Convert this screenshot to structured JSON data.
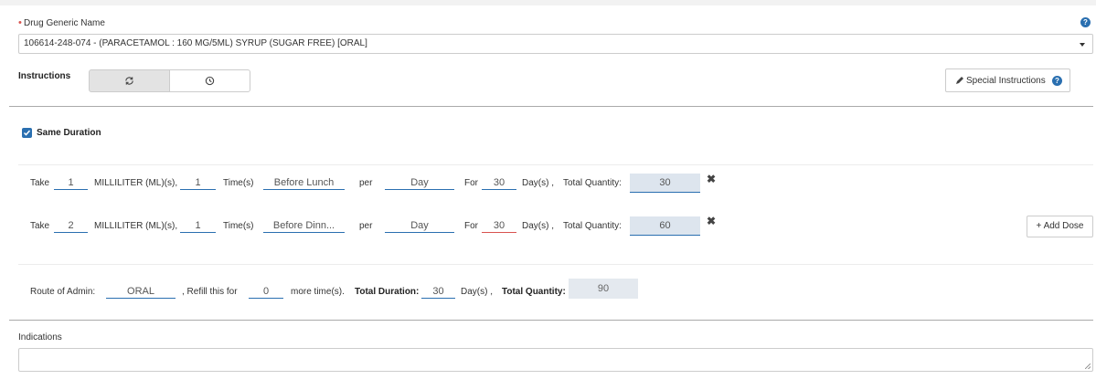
{
  "drug": {
    "label": "Drug Generic Name",
    "required_mark": "•",
    "help": "?",
    "selected": "106614-248-074 - (PARACETAMOL : 160 MG/5ML) SYRUP (SUGAR FREE) [ORAL]"
  },
  "instructions": {
    "label": "Instructions",
    "special_label": "Special Instructions",
    "special_help": "?"
  },
  "same_duration": {
    "label": "Same Duration",
    "checked": true
  },
  "doses": [
    {
      "take": "Take",
      "amount": "1",
      "unit": "MILLILITER (ML)(s),",
      "times": "1",
      "times_label": "Time(s)",
      "timing": "Before Lunch",
      "per": "per",
      "period": "Day",
      "for": "For",
      "duration": "30",
      "duration_unit": "Day(s) ,",
      "total_label": "Total Quantity:",
      "total": "30"
    },
    {
      "take": "Take",
      "amount": "2",
      "unit": "MILLILITER (ML)(s),",
      "times": "1",
      "times_label": "Time(s)",
      "timing": "Before Dinn...",
      "per": "per",
      "period": "Day",
      "for": "For",
      "duration": "30",
      "duration_unit": "Day(s) ,",
      "total_label": "Total Quantity:",
      "total": "60"
    }
  ],
  "add_dose_label": "+ Add Dose",
  "summary": {
    "route_label": "Route of Admin:",
    "route": "ORAL",
    "refill_label": ", Refill this for",
    "refill": "0",
    "more_label": "more time(s).",
    "total_duration_label": "Total Duration:",
    "total_duration": "30",
    "days_label": "Day(s) ,",
    "total_quantity_label": "Total Quantity:",
    "total_quantity": "90"
  },
  "indications": {
    "label": "Indications",
    "value": ""
  },
  "colors": {
    "accent": "#2a6fb0",
    "required": "#d9534f",
    "error_underline": "#d9534f"
  }
}
